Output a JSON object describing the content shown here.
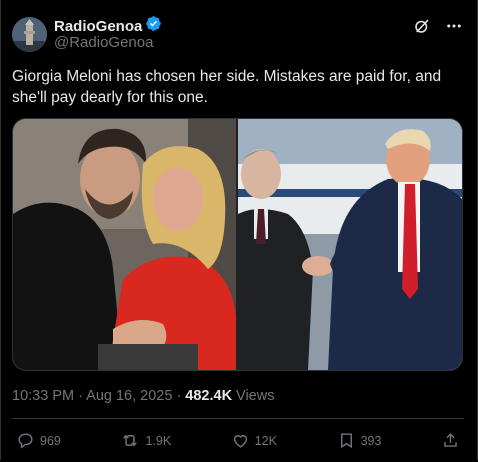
{
  "tweet": {
    "author": {
      "name": "RadioGenoa",
      "handle": "@RadioGenoa",
      "verified": true,
      "verified_color": "#1d9bf0"
    },
    "text": "Giorgia Meloni has chosen her side. Mistakes are paid for, and she'll pay dearly for this one.",
    "image_left_alt": "",
    "image_right_alt": "",
    "timestamp": "10:33 PM · Aug 16, 2025 · ",
    "views_count": "482.4K",
    "views_label": " Views"
  },
  "actions": {
    "replies": "969",
    "reposts": "1.9K",
    "likes": "12K",
    "bookmarks": "393"
  },
  "icons": [
    "grok-icon",
    "more-icon",
    "reply-icon",
    "repost-icon",
    "like-icon",
    "bookmark-icon",
    "share-icon"
  ],
  "colors": {
    "background": "#000000",
    "text": "#e7e9ea",
    "muted": "#71767b",
    "border": "#2f3336"
  }
}
